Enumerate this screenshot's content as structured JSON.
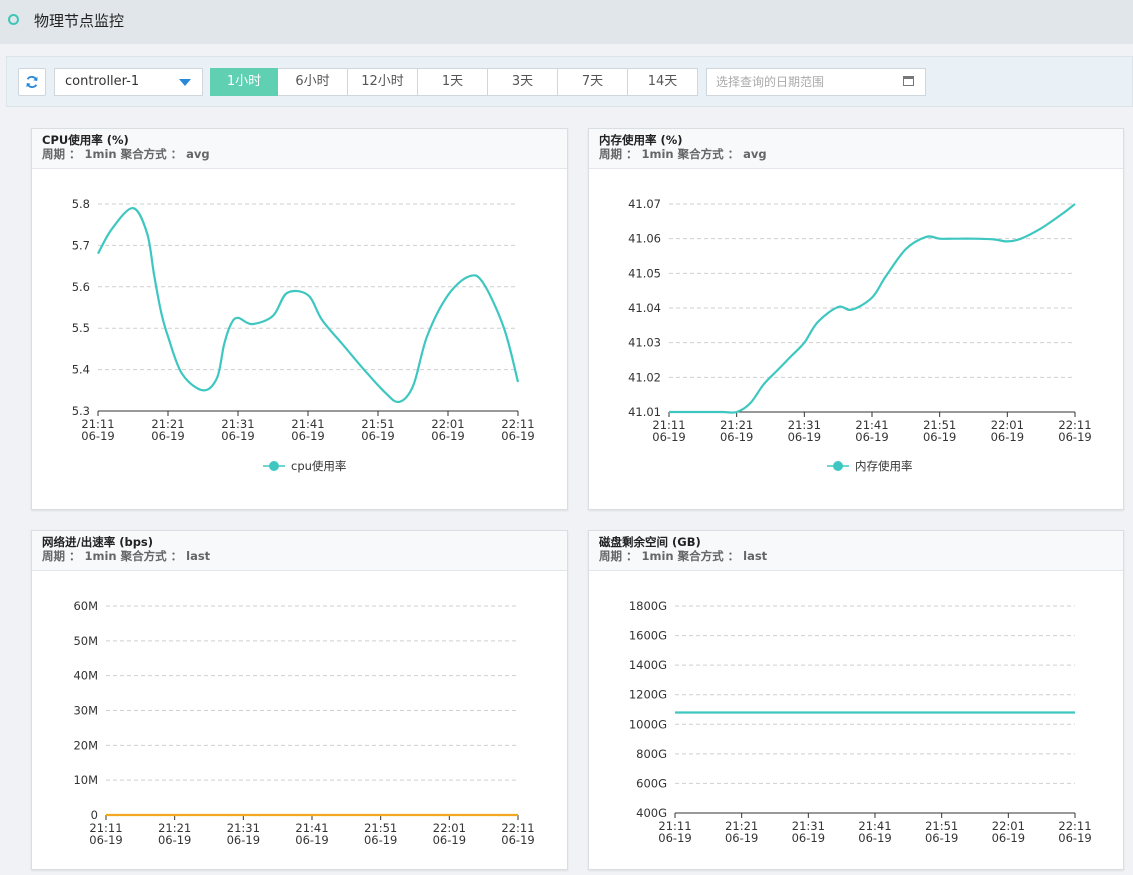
{
  "page": {
    "title": "物理节点监控"
  },
  "toolbar": {
    "node": "controller-1",
    "ranges": [
      "1小时",
      "6小时",
      "12小时",
      "1天",
      "3天",
      "7天",
      "14天"
    ],
    "active_range": "1小时",
    "date_placeholder": "选择查询的日期范围"
  },
  "colors": {
    "series": "#3ec7c1",
    "network_line": "#f5a623",
    "active": "#5fd0b2"
  },
  "x_ticks": [
    {
      "time": "21:11",
      "date": "06-19"
    },
    {
      "time": "21:21",
      "date": "06-19"
    },
    {
      "time": "21:31",
      "date": "06-19"
    },
    {
      "time": "21:41",
      "date": "06-19"
    },
    {
      "time": "21:51",
      "date": "06-19"
    },
    {
      "time": "22:01",
      "date": "06-19"
    },
    {
      "time": "22:11",
      "date": "06-19"
    }
  ],
  "panels": [
    {
      "title": "CPU使用率 (%)",
      "sub": "周期 ： 1min 聚合方式 ： avg"
    },
    {
      "title": "内存使用率 (%)",
      "sub": "周期 ： 1min 聚合方式 ： avg"
    },
    {
      "title": "网络进/出速率 (bps)",
      "sub": "周期 ： 1min 聚合方式 ： last"
    },
    {
      "title": "磁盘剩余空间 (GB)",
      "sub": "周期 ： 1min 聚合方式 ： last"
    }
  ],
  "chart_data": [
    {
      "type": "line",
      "title": "CPU使用率 (%)",
      "yticks": [
        "5.3",
        "5.4",
        "5.5",
        "5.6",
        "5.7",
        "5.8"
      ],
      "ylim": [
        5.3,
        5.8
      ],
      "xlim": [
        0,
        60
      ],
      "x": [
        0,
        2,
        5,
        7,
        8,
        9,
        10,
        12,
        15,
        17,
        18,
        19,
        20,
        22,
        25,
        27,
        30,
        32,
        35,
        38,
        41,
        43,
        45,
        47,
        50,
        53,
        55,
        58,
        60
      ],
      "series": [
        {
          "name": "cpu使用率",
          "values": [
            5.68,
            5.74,
            5.79,
            5.73,
            5.63,
            5.54,
            5.48,
            5.39,
            5.35,
            5.38,
            5.46,
            5.51,
            5.525,
            5.51,
            5.53,
            5.585,
            5.58,
            5.52,
            5.46,
            5.4,
            5.345,
            5.322,
            5.36,
            5.48,
            5.58,
            5.625,
            5.61,
            5.5,
            5.37
          ]
        }
      ],
      "legend": "bottom-center"
    },
    {
      "type": "line",
      "title": "内存使用率 (%)",
      "yticks": [
        "41.01",
        "41.02",
        "41.03",
        "41.04",
        "41.05",
        "41.06",
        "41.07"
      ],
      "ylim": [
        41.01,
        41.07
      ],
      "xlim": [
        0,
        60
      ],
      "x": [
        0,
        5,
        8,
        10,
        12,
        14,
        16,
        18,
        20,
        22,
        25,
        27,
        30,
        32,
        35,
        38,
        40,
        42,
        45,
        48,
        50,
        52,
        55,
        58,
        60
      ],
      "series": [
        {
          "name": "内存使用率",
          "values": [
            41.01,
            41.01,
            41.01,
            41.01,
            41.0125,
            41.018,
            41.022,
            41.026,
            41.03,
            41.036,
            41.0403,
            41.0395,
            41.043,
            41.049,
            41.057,
            41.0605,
            41.06,
            41.06,
            41.06,
            41.0598,
            41.0592,
            41.06,
            41.063,
            41.067,
            41.07
          ]
        }
      ],
      "legend": "bottom-center"
    },
    {
      "type": "line",
      "title": "网络进/出速率 (bps)",
      "yticks": [
        "0",
        "10M",
        "20M",
        "30M",
        "40M",
        "50M",
        "60M"
      ],
      "ylim": [
        0,
        60000000
      ],
      "xlim": [
        0,
        60
      ],
      "x": [
        0,
        60
      ],
      "series": [
        {
          "values": [
            0,
            0
          ]
        }
      ]
    },
    {
      "type": "line",
      "title": "磁盘剩余空间 (GB)",
      "yticks": [
        "400G",
        "600G",
        "800G",
        "1000G",
        "1200G",
        "1400G",
        "1600G",
        "1800G"
      ],
      "ylim": [
        400,
        1800
      ],
      "xlim": [
        0,
        60
      ],
      "x": [
        0,
        60
      ],
      "series": [
        {
          "values": [
            1080,
            1080
          ]
        }
      ]
    }
  ]
}
